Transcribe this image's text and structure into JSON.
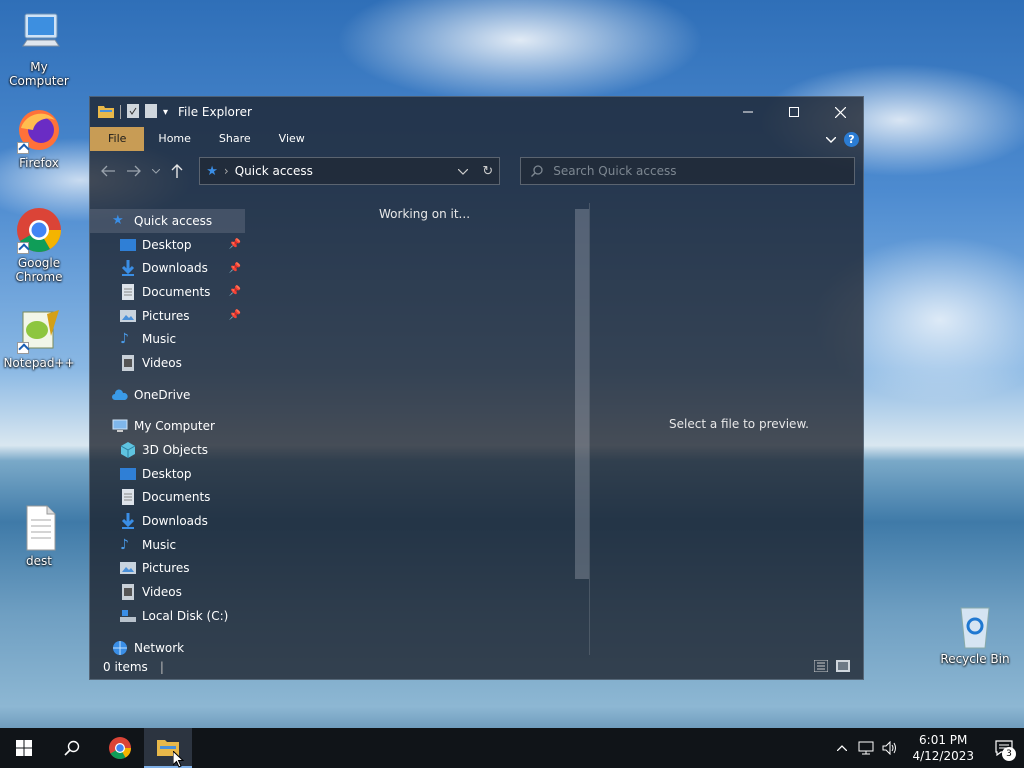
{
  "desktop": {
    "icons": [
      {
        "label": "My Computer"
      },
      {
        "label": "Firefox"
      },
      {
        "label": "Google Chrome"
      },
      {
        "label": "Notepad++"
      },
      {
        "label": "dest"
      },
      {
        "label": "Recycle Bin"
      }
    ]
  },
  "explorer": {
    "title": "File Explorer",
    "tabs": {
      "file": "File",
      "home": "Home",
      "share": "Share",
      "view": "View"
    },
    "address": {
      "location": "Quick access",
      "separator": "›"
    },
    "search": {
      "placeholder": "Search Quick access"
    },
    "nav": {
      "quick_access": "Quick access",
      "desktop": "Desktop",
      "downloads": "Downloads",
      "documents": "Documents",
      "pictures": "Pictures",
      "music": "Music",
      "videos": "Videos",
      "onedrive": "OneDrive",
      "my_computer": "My Computer",
      "objects3d": "3D Objects",
      "pc_desktop": "Desktop",
      "pc_documents": "Documents",
      "pc_downloads": "Downloads",
      "pc_music": "Music",
      "pc_pictures": "Pictures",
      "pc_videos": "Videos",
      "local_disk": "Local Disk (C:)",
      "network": "Network"
    },
    "content": {
      "status_message": "Working on it...",
      "preview_message": "Select a file to preview."
    },
    "statusbar": {
      "items": "0 items",
      "divider": "|"
    }
  },
  "taskbar": {
    "time": "6:01 PM",
    "date": "4/12/2023",
    "notification_count": "3"
  },
  "colors": {
    "accent": "#2b7cd3",
    "file_tab": "#c89c55",
    "taskbar": "#101418"
  }
}
